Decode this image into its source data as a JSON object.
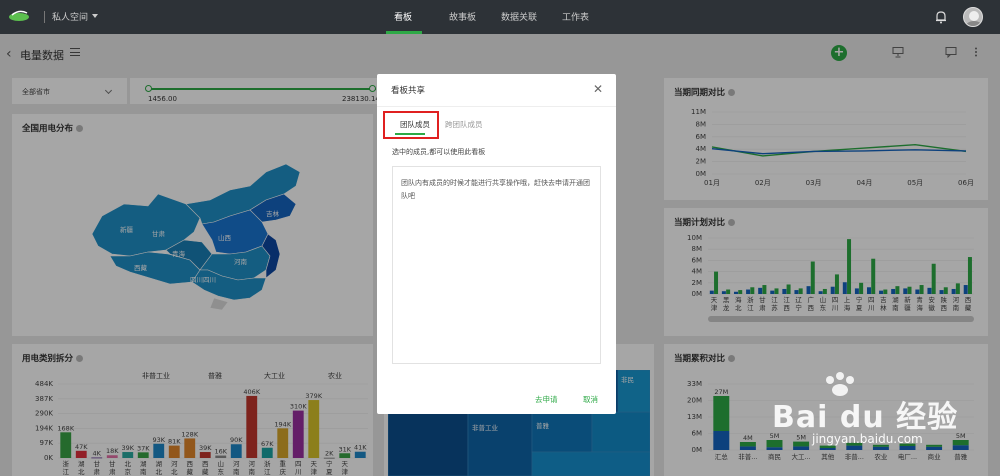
{
  "topbar": {
    "space_label": "私人空间",
    "nav": [
      {
        "label": "看板",
        "active": true
      },
      {
        "label": "故事板",
        "active": false
      },
      {
        "label": "数据关联",
        "active": false
      },
      {
        "label": "工作表",
        "active": false
      }
    ]
  },
  "subbar": {
    "title": "电量数据"
  },
  "filters": {
    "city_select": "全部省市",
    "range_min": "1456.00",
    "range_max": "238130.14",
    "range_low_fraction": 0.0,
    "range_high_fraction": 1.0
  },
  "cards": {
    "map": {
      "title": "全国用电分布",
      "labels": [
        "新疆",
        "甘肃",
        "青海",
        "西藏",
        "四川",
        "山西",
        "吉林",
        "河南",
        "四川四川"
      ]
    },
    "category": {
      "title": "用电类别拆分",
      "group_labels": [
        "非普工业",
        "普雅",
        "大工业",
        "农业"
      ]
    },
    "yoy": {
      "title": "当期同期对比"
    },
    "plan": {
      "title": "当期计划对比"
    },
    "cumulative": {
      "title": "当期累积对比"
    },
    "treemap": {
      "labels": [
        "非普工业",
        "普雅",
        "非民"
      ]
    }
  },
  "modal": {
    "title": "看板共享",
    "tab_team": "团队成员",
    "tab_cross_team": "跨团队成员",
    "hint": "选中的成员,都可以使用此看板",
    "empty_text": "团队内有成员的时候才能进行共享操作哦，赶快去申请开通团队吧",
    "apply_label": "去申请",
    "cancel_label": "取消"
  },
  "watermark": {
    "brand": "Bai du 经验",
    "url": "jingyan.baidu.com"
  },
  "colors": {
    "accent": "#2da946",
    "blue": "#1565c0",
    "map_blue": "#1f8fc7"
  },
  "chart_data": [
    {
      "id": "category",
      "type": "bar",
      "title": "用电类别拆分",
      "yticks": [
        "484K",
        "387K",
        "290K",
        "194K",
        "97K",
        "0K"
      ],
      "ylim": [
        0,
        484000
      ],
      "categories": [
        "浙江",
        "湖北",
        "甘肃",
        "甘肃",
        "北京",
        "湖南",
        "湖北",
        "河北",
        "西藏",
        "西藏",
        "山东",
        "河南",
        "河南",
        "浙江",
        "重庆",
        "四川",
        "天津",
        "宁夏",
        "天津"
      ],
      "values": [
        168000,
        47000,
        4000,
        18000,
        39000,
        37000,
        93000,
        81000,
        128000,
        39000,
        16000,
        90000,
        406000,
        67000,
        194000,
        310000,
        379000,
        2000,
        31000,
        41000
      ],
      "value_labels": [
        "168K",
        "47K",
        "4K",
        "18K",
        "39K",
        "37K",
        "93K",
        "81K",
        "128K",
        "39K",
        "16K",
        "90K",
        "406K",
        "67K",
        "194K",
        "310K",
        "379K",
        "2K",
        "31K",
        "41K"
      ],
      "colors": [
        "#3aa445",
        "#e0313c",
        "#7d5aa6",
        "#e36fa6",
        "#2aa9a0",
        "#3aa445",
        "#1e88c8",
        "#e0862a",
        "#e0862a",
        "#c2362d",
        "#8a8a8a",
        "#1e88c8",
        "#c2362d",
        "#1aa3a3",
        "#d8a62a",
        "#9a2fa0",
        "#d8c42a",
        "#8a8a8a",
        "#3aa445",
        "#1e88c8"
      ]
    },
    {
      "id": "yoy",
      "type": "line",
      "title": "当期同期对比",
      "categories": [
        "01月",
        "02月",
        "03月",
        "04月",
        "05月",
        "06月"
      ],
      "yticks": [
        "11M",
        "8M",
        "6M",
        "4M",
        "2M",
        "0M"
      ],
      "ylim": [
        0,
        11
      ],
      "series": [
        {
          "values": [
            4.8,
            3.2,
            4.0,
            4.6,
            5.2,
            4.0
          ],
          "color": "#2da946"
        },
        {
          "values": [
            4.5,
            3.6,
            4.0,
            4.1,
            4.3,
            4.1
          ],
          "color": "#1565c0"
        }
      ]
    },
    {
      "id": "plan",
      "type": "bar",
      "title": "当期计划对比",
      "yticks": [
        "10M",
        "8M",
        "6M",
        "4M",
        "2M",
        "0M"
      ],
      "ylim": [
        0,
        10
      ],
      "categories": [
        "天津",
        "黑龙",
        "海北",
        "浙江",
        "甘肃",
        "江苏",
        "江西",
        "辽宁",
        "广西",
        "山东",
        "四川",
        "上海",
        "宁夏",
        "四川",
        "吉林",
        "湖南",
        "新疆",
        "青海",
        "安徽",
        "陕西",
        "河南",
        "西藏"
      ],
      "series": [
        {
          "values": [
            0.6,
            0.5,
            0.4,
            0.8,
            1.1,
            0.6,
            0.9,
            0.7,
            1.4,
            0.5,
            1.3,
            2.1,
            1.0,
            1.2,
            0.6,
            0.9,
            1.0,
            0.8,
            1.1,
            0.7,
            0.9,
            1.6
          ],
          "color": "#1565c0"
        },
        {
          "values": [
            4.0,
            0.8,
            0.7,
            1.2,
            1.6,
            1.0,
            1.7,
            1.0,
            5.8,
            0.9,
            3.5,
            9.8,
            2.0,
            6.3,
            0.8,
            1.4,
            1.3,
            1.6,
            5.4,
            1.2,
            1.9,
            6.6
          ],
          "color": "#2da946"
        }
      ]
    },
    {
      "id": "cumulative",
      "type": "bar",
      "title": "当期累积对比",
      "yticks": [
        "33M",
        "20M",
        "13M",
        "6M",
        "0M"
      ],
      "ylim": [
        0,
        33
      ],
      "categories": [
        "汇总",
        "非普...",
        "商民",
        "大工...",
        "其他",
        "非普...",
        "农业",
        "电厂...",
        "商业",
        "普雅"
      ],
      "series": [
        {
          "values": [
            9.5,
            1.8,
            1.4,
            1.8,
            1.0,
            2.2,
            1.6,
            2.0,
            1.6,
            2.4
          ],
          "color": "#1565c0"
        },
        {
          "values": [
            17.5,
            2.2,
            3.6,
            2.4,
            1.2,
            1.4,
            1.0,
            1.2,
            1.0,
            2.6
          ],
          "color": "#2da946"
        }
      ],
      "value_labels": [
        "27M",
        "4M",
        "5M",
        "5M",
        "",
        "",
        "",
        "",
        "",
        "5M"
      ]
    }
  ]
}
